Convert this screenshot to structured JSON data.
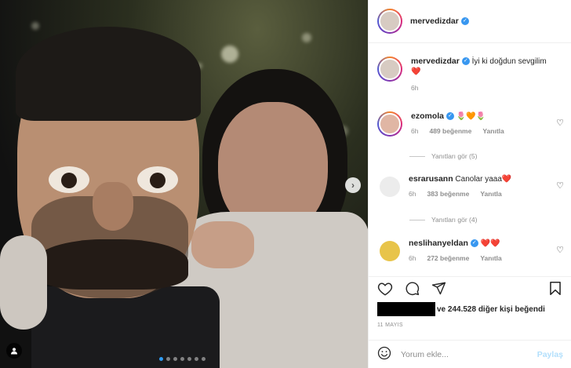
{
  "post": {
    "author": "mervedizdar",
    "caption": "İyi ki doğdun sevgilim",
    "caption_emoji": "❤️",
    "caption_time": "6h",
    "photo_dots": 7,
    "photo_active_dot": 0
  },
  "comments": [
    {
      "user": "ezomola",
      "verified": true,
      "text": "",
      "emoji": "🌷🧡🌷",
      "time": "6h",
      "likes": "489 beğenme",
      "reply": "Yanıtla",
      "view_replies": "Yanıtları gör (5)"
    },
    {
      "user": "esrarusann",
      "verified": false,
      "text": "Canolar yaaa",
      "emoji": "❤️",
      "time": "6h",
      "likes": "383 beğenme",
      "reply": "Yanıtla",
      "view_replies": "Yanıtları gör (4)"
    },
    {
      "user": "neslihanyeldan",
      "verified": true,
      "text": "",
      "emoji": "❤️❤️",
      "time": "6h",
      "likes": "272 beğenme",
      "reply": "Yanıtla",
      "view_replies": ""
    }
  ],
  "likes_text": "ve 244.528 diğer kişi beğendi",
  "date": "11 MAYIS",
  "comment_box": {
    "placeholder": "Yorum ekle...",
    "post_label": "Paylaş"
  },
  "colors": {
    "verified": "#3897f0",
    "link_disabled": "#b2dffc",
    "active_dot": "#2f9cf4",
    "heart": "#ed4956"
  },
  "icons": [
    "heart-icon",
    "comment-icon",
    "share-icon",
    "save-icon",
    "emoji-icon",
    "next-arrow-icon",
    "tag-user-icon"
  ]
}
